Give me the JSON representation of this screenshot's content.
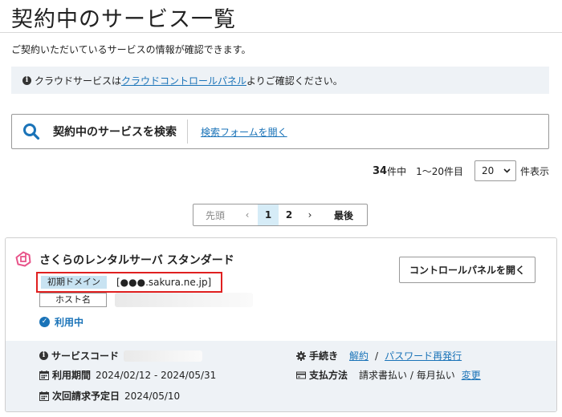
{
  "page": {
    "title": "契約中のサービス一覧",
    "intro": "ご契約いただいているサービスの情報が確認できます。"
  },
  "info": {
    "prefix": "クラウドサービスは",
    "link": "クラウドコントロールパネル",
    "suffix": "よりご確認ください。"
  },
  "search": {
    "label": "契約中のサービスを検索",
    "link": "検索フォームを開く"
  },
  "summary": {
    "total": "34",
    "total_suffix": "件中",
    "range": "1〜20件目",
    "per_page": "20",
    "per_page_suffix": "件表示"
  },
  "pager": {
    "first": "先頭",
    "prev": "‹",
    "pages": [
      "1",
      "2"
    ],
    "current": "1",
    "next": "›",
    "last": "最後"
  },
  "service": {
    "name": "さくらのレンタルサーバ スタンダード",
    "domain_badge": "初期ドメイン",
    "domain_value": "[●●●.sakura.ne.jp]",
    "host_badge": "ホスト名",
    "status": "利用中",
    "control_panel_button": "コントロールパネルを開く",
    "service_code_label": "サービスコード",
    "period_label": "利用期間",
    "period_value": "2024/02/12 - 2024/05/31",
    "next_billing_label": "次回請求予定日",
    "next_billing_value": "2024/05/10",
    "procedures_label": "手続き",
    "procedure_cancel": "解約",
    "procedure_sep": "/",
    "procedure_password": "パスワード再発行",
    "payment_label": "支払方法",
    "payment_value": "請求書払い / 毎月払い",
    "payment_change": "変更"
  },
  "colors": {
    "accent": "#1a73b8",
    "highlight_border": "#e02020",
    "logo": "#e8548a",
    "panel_bg": "#eef2f6"
  }
}
